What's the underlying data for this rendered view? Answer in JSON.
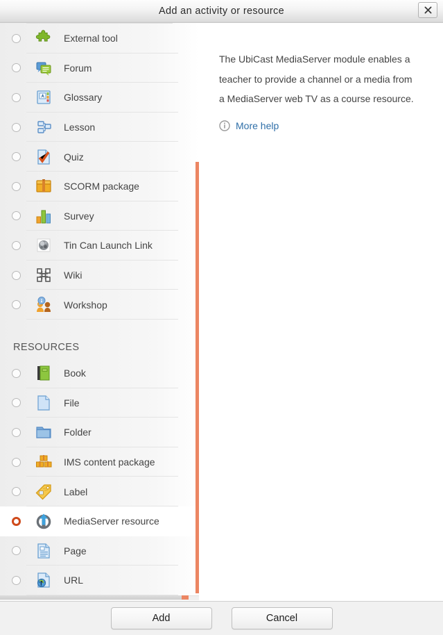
{
  "titlebar": {
    "title": "Add an activity or resource",
    "close_label": "Close"
  },
  "list": {
    "activities": [
      {
        "label": "External tool",
        "icon": "puzzle-icon",
        "selected": false
      },
      {
        "label": "Forum",
        "icon": "forum-icon",
        "selected": false
      },
      {
        "label": "Glossary",
        "icon": "glossary-icon",
        "selected": false
      },
      {
        "label": "Lesson",
        "icon": "lesson-icon",
        "selected": false
      },
      {
        "label": "Quiz",
        "icon": "quiz-icon",
        "selected": false
      },
      {
        "label": "SCORM package",
        "icon": "scorm-icon",
        "selected": false
      },
      {
        "label": "Survey",
        "icon": "survey-icon",
        "selected": false
      },
      {
        "label": "Tin Can Launch Link",
        "icon": "tincan-icon",
        "selected": false
      },
      {
        "label": "Wiki",
        "icon": "wiki-icon",
        "selected": false
      },
      {
        "label": "Workshop",
        "icon": "workshop-icon",
        "selected": false
      }
    ],
    "resources_heading": "RESOURCES",
    "resources": [
      {
        "label": "Book",
        "icon": "book-icon",
        "selected": false
      },
      {
        "label": "File",
        "icon": "file-icon",
        "selected": false
      },
      {
        "label": "Folder",
        "icon": "folder-icon",
        "selected": false
      },
      {
        "label": "IMS content package",
        "icon": "ims-package-icon",
        "selected": false
      },
      {
        "label": "Label",
        "icon": "label-tag-icon",
        "selected": false
      },
      {
        "label": "MediaServer resource",
        "icon": "mediaserver-icon",
        "selected": true
      },
      {
        "label": "Page",
        "icon": "page-icon",
        "selected": false
      },
      {
        "label": "URL",
        "icon": "url-icon",
        "selected": false
      }
    ]
  },
  "detail": {
    "description": "The UbiCast MediaServer module enables a teacher to provide a channel or a media from a MediaServer web TV as a course resource.",
    "more_help": "More help",
    "info_icon": "info-circle-icon"
  },
  "footer": {
    "add_label": "Add",
    "cancel_label": "Cancel"
  },
  "colors": {
    "accent_orange": "#ec8663",
    "selected_radio": "#cf4a1b",
    "link_blue": "#2f6fa8"
  }
}
